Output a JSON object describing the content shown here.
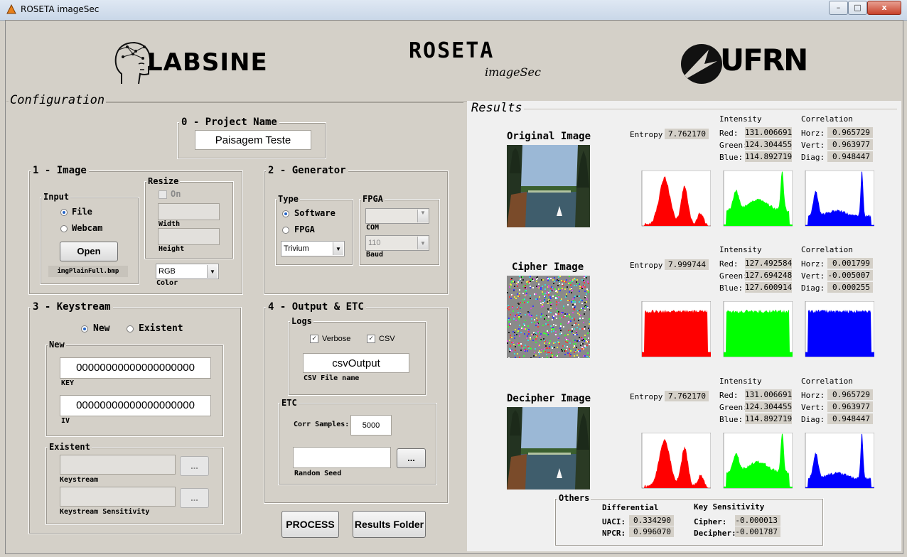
{
  "window": {
    "title": "ROSETA imageSec",
    "min": "–",
    "max": "□",
    "close": "x"
  },
  "header": {
    "lab_logo": "LABSINE",
    "app_name": "ROSETA",
    "app_sub": "imageSec",
    "uni_logo": "UFRN"
  },
  "config": {
    "title": "Configuration",
    "project": {
      "title": "0 - Project Name",
      "value": "Paisagem Teste"
    },
    "image": {
      "title": "1 - Image",
      "input": {
        "title": "Input",
        "file": "File",
        "webcam": "Webcam",
        "open": "Open",
        "filename": "imgPlainFull.bmp"
      },
      "resize": {
        "title": "Resize",
        "on": "On",
        "width": "Width",
        "height": "Height"
      },
      "color": {
        "value": "RGB",
        "label": "Color"
      }
    },
    "generator": {
      "title": "2 - Generator",
      "type": {
        "title": "Type",
        "software": "Software",
        "fpga": "FPGA",
        "cipher": "Trivium"
      },
      "fpga": {
        "title": "FPGA",
        "com_label": "COM",
        "baud_value": "110",
        "baud_label": "Baud"
      }
    },
    "keystream": {
      "title": "3 - Keystream",
      "new_radio": "New",
      "existent_radio": "Existent",
      "new": {
        "title": "New",
        "key": "00000000000000000000",
        "key_label": "KEY",
        "iv": "00000000000000000000",
        "iv_label": "IV"
      },
      "existent": {
        "title": "Existent",
        "keystream_label": "Keystream",
        "sens_label": "Keystream Sensitivity",
        "browse": "..."
      }
    },
    "output": {
      "title": "4 - Output & ETC",
      "logs": {
        "title": "Logs",
        "verbose": "Verbose",
        "csv": "CSV",
        "csv_name": "csvOutput",
        "csv_label": "CSV File name"
      },
      "etc": {
        "title": "ETC",
        "corr_label": "Corr Samples:",
        "corr_value": "5000",
        "seed_label": "Random Seed",
        "browse": "..."
      }
    },
    "process": "PROCESS",
    "results_folder": "Results Folder"
  },
  "results": {
    "title": "Results",
    "rows": [
      {
        "name": "Original Image",
        "entropy": "7.762170",
        "red": "131.006691",
        "green": "124.304455",
        "blue": "114.892719",
        "horz": "0.965729",
        "vert": "0.963977",
        "diag": "0.948447"
      },
      {
        "name": "Cipher Image",
        "entropy": "7.999744",
        "red": "127.492584",
        "green": "127.694248",
        "blue": "127.600914",
        "horz": "0.001799",
        "vert": "-0.005007",
        "diag": "0.000255"
      },
      {
        "name": "Decipher Image",
        "entropy": "7.762170",
        "red": "131.006691",
        "green": "124.304455",
        "blue": "114.892719",
        "horz": "0.965729",
        "vert": "0.963977",
        "diag": "0.948447"
      }
    ],
    "labels": {
      "entropy": "Entropy:",
      "intensity": "Intensity",
      "correlation": "Correlation",
      "red": "Red:",
      "green": "Green:",
      "blue": "Blue:",
      "horz": "Horz:",
      "vert": "Vert:",
      "diag": "Diag:"
    },
    "others": {
      "title": "Others",
      "differential": "Differential",
      "uaci_label": "UACI:",
      "uaci": "0.334290",
      "npcr_label": "NPCR:",
      "npcr": "0.996070",
      "key_sens": "Key Sensitivity",
      "cipher_label": "Cipher:",
      "cipher": "-0.000013",
      "decipher_label": "Decipher:",
      "decipher": "-0.001787"
    }
  },
  "colors": {
    "red": "#ff0000",
    "green": "#00ff00",
    "blue": "#0000ff",
    "panel": "#d4d0c8",
    "results_bg": "#f0f0f0"
  }
}
